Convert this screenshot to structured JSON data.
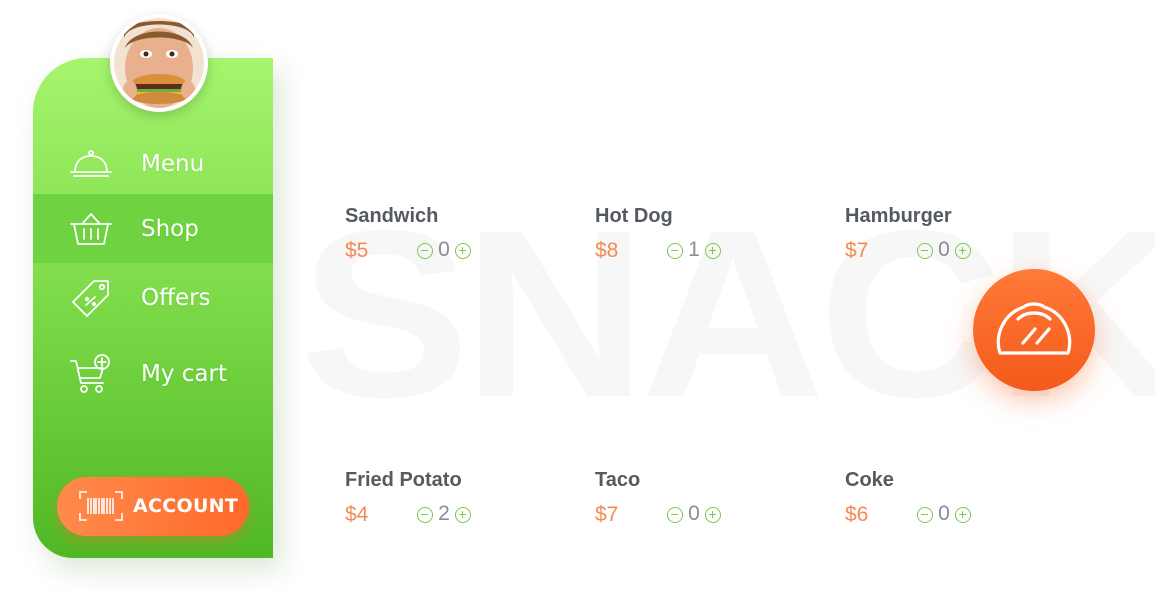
{
  "background_word": "SNACK",
  "sidebar": {
    "items": [
      {
        "label": "Menu",
        "icon": "cloche-icon"
      },
      {
        "label": "Shop",
        "icon": "basket-icon",
        "active": true
      },
      {
        "label": "Offers",
        "icon": "tag-icon"
      },
      {
        "label": "My cart",
        "icon": "cart-add-icon"
      }
    ],
    "account_label": "ACCOUNT",
    "account_icon": "barcode-scan-icon"
  },
  "products": [
    {
      "name": "Sandwich",
      "price": "$5",
      "qty": "0"
    },
    {
      "name": "Hot Dog",
      "price": "$8",
      "qty": "1"
    },
    {
      "name": "Hamburger",
      "price": "$7",
      "qty": "0"
    },
    {
      "name": "Fried Potato",
      "price": "$4",
      "qty": "2"
    },
    {
      "name": "Taco",
      "price": "$7",
      "qty": "0"
    },
    {
      "name": "Coke",
      "price": "$6",
      "qty": "0"
    }
  ],
  "fab_icon": "taco-icon",
  "colors": {
    "sidebar_top": "#a6f56e",
    "sidebar_bottom": "#4fb824",
    "accent_orange": "#ff6a2a",
    "price": "#f58a52",
    "stepper_green": "#7cc94c"
  }
}
